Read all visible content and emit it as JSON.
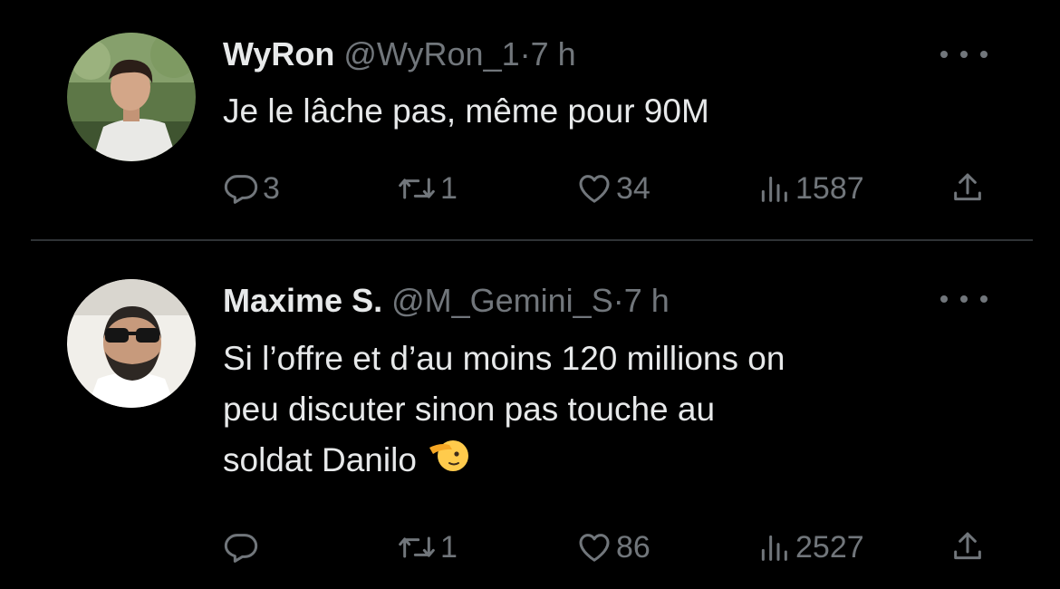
{
  "tweets": [
    {
      "name": "WyRon",
      "handle": "@WyRon_1",
      "separator": "·",
      "time": "7 h",
      "text": "Je le lâche pas, même pour 90M",
      "replies": "3",
      "retweets": "1",
      "likes": "34",
      "views": "1587"
    },
    {
      "name": "Maxime S.",
      "handle": "@M_Gemini_S",
      "separator": "·",
      "time": "7 h",
      "text": "Si l’offre et d’au moins 120 millions on\npeu discuter sinon pas touche au\nsoldat Danilo",
      "emoji": "saluting-face",
      "replies": "",
      "retweets": "1",
      "likes": "86",
      "views": "2527"
    }
  ],
  "icons": {
    "reply": "reply-icon",
    "retweet": "retweet-icon",
    "like": "heart-icon",
    "views": "views-icon",
    "share": "share-icon",
    "more": "more-icon"
  },
  "colors": {
    "background": "#000000",
    "text": "#e7e9ea",
    "secondary": "#71767b",
    "divider": "#2f3336"
  }
}
